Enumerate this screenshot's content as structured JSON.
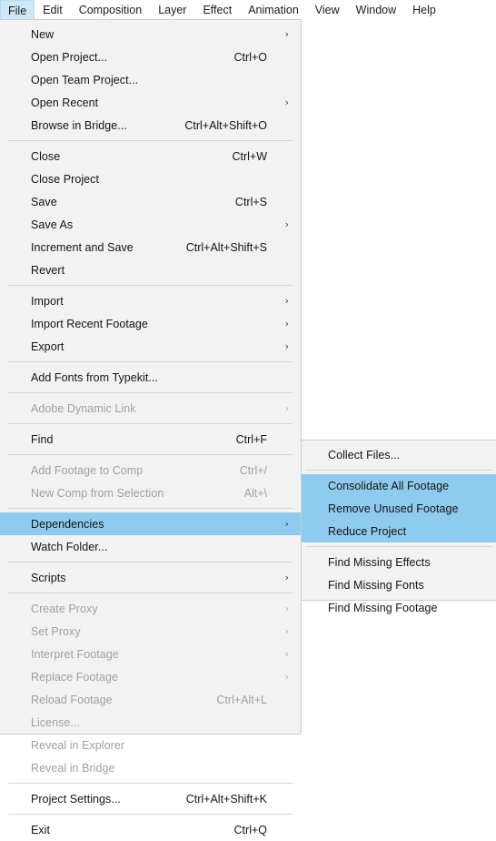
{
  "menubar": {
    "items": [
      {
        "label": "File",
        "active": true
      },
      {
        "label": "Edit",
        "active": false
      },
      {
        "label": "Composition",
        "active": false
      },
      {
        "label": "Layer",
        "active": false
      },
      {
        "label": "Effect",
        "active": false
      },
      {
        "label": "Animation",
        "active": false
      },
      {
        "label": "View",
        "active": false
      },
      {
        "label": "Window",
        "active": false
      },
      {
        "label": "Help",
        "active": false
      }
    ]
  },
  "colors": {
    "highlight": "#8fcbee",
    "menu_background": "#f2f2f2",
    "menubar_active": "#cce8f7",
    "text": "#141414",
    "text_disabled": "#a0a0a0",
    "separator": "#d6d6d6",
    "border": "#cdcdcd"
  },
  "file_menu": {
    "groups": [
      {
        "items": [
          {
            "label": "New",
            "accel": "",
            "submenu": true,
            "disabled": false,
            "highlight": false
          },
          {
            "label": "Open Project...",
            "accel": "Ctrl+O",
            "submenu": false,
            "disabled": false,
            "highlight": false
          },
          {
            "label": "Open Team Project...",
            "accel": "",
            "submenu": false,
            "disabled": false,
            "highlight": false
          },
          {
            "label": "Open Recent",
            "accel": "",
            "submenu": true,
            "disabled": false,
            "highlight": false
          },
          {
            "label": "Browse in Bridge...",
            "accel": "Ctrl+Alt+Shift+O",
            "submenu": false,
            "disabled": false,
            "highlight": false
          }
        ]
      },
      {
        "items": [
          {
            "label": "Close",
            "accel": "Ctrl+W",
            "submenu": false,
            "disabled": false,
            "highlight": false
          },
          {
            "label": "Close Project",
            "accel": "",
            "submenu": false,
            "disabled": false,
            "highlight": false
          },
          {
            "label": "Save",
            "accel": "Ctrl+S",
            "submenu": false,
            "disabled": false,
            "highlight": false
          },
          {
            "label": "Save As",
            "accel": "",
            "submenu": true,
            "disabled": false,
            "highlight": false
          },
          {
            "label": "Increment and Save",
            "accel": "Ctrl+Alt+Shift+S",
            "submenu": false,
            "disabled": false,
            "highlight": false
          },
          {
            "label": "Revert",
            "accel": "",
            "submenu": false,
            "disabled": false,
            "highlight": false
          }
        ]
      },
      {
        "items": [
          {
            "label": "Import",
            "accel": "",
            "submenu": true,
            "disabled": false,
            "highlight": false
          },
          {
            "label": "Import Recent Footage",
            "accel": "",
            "submenu": true,
            "disabled": false,
            "highlight": false
          },
          {
            "label": "Export",
            "accel": "",
            "submenu": true,
            "disabled": false,
            "highlight": false
          }
        ]
      },
      {
        "items": [
          {
            "label": "Add Fonts from Typekit...",
            "accel": "",
            "submenu": false,
            "disabled": false,
            "highlight": false
          }
        ]
      },
      {
        "items": [
          {
            "label": "Adobe Dynamic Link",
            "accel": "",
            "submenu": true,
            "disabled": true,
            "highlight": false
          }
        ]
      },
      {
        "items": [
          {
            "label": "Find",
            "accel": "Ctrl+F",
            "submenu": false,
            "disabled": false,
            "highlight": false
          }
        ]
      },
      {
        "items": [
          {
            "label": "Add Footage to Comp",
            "accel": "Ctrl+/",
            "submenu": false,
            "disabled": true,
            "highlight": false
          },
          {
            "label": "New Comp from Selection",
            "accel": "Alt+\\",
            "submenu": false,
            "disabled": true,
            "highlight": false
          }
        ]
      },
      {
        "items": [
          {
            "label": "Dependencies",
            "accel": "",
            "submenu": true,
            "disabled": false,
            "highlight": true
          },
          {
            "label": "Watch Folder...",
            "accel": "",
            "submenu": false,
            "disabled": false,
            "highlight": false
          }
        ]
      },
      {
        "items": [
          {
            "label": "Scripts",
            "accel": "",
            "submenu": true,
            "disabled": false,
            "highlight": false
          }
        ]
      },
      {
        "items": [
          {
            "label": "Create Proxy",
            "accel": "",
            "submenu": true,
            "disabled": true,
            "highlight": false
          },
          {
            "label": "Set Proxy",
            "accel": "",
            "submenu": true,
            "disabled": true,
            "highlight": false
          },
          {
            "label": "Interpret Footage",
            "accel": "",
            "submenu": true,
            "disabled": true,
            "highlight": false
          },
          {
            "label": "Replace Footage",
            "accel": "",
            "submenu": true,
            "disabled": true,
            "highlight": false
          },
          {
            "label": "Reload Footage",
            "accel": "Ctrl+Alt+L",
            "submenu": false,
            "disabled": true,
            "highlight": false
          },
          {
            "label": "License...",
            "accel": "",
            "submenu": false,
            "disabled": true,
            "highlight": false
          },
          {
            "label": "Reveal in Explorer",
            "accel": "",
            "submenu": false,
            "disabled": true,
            "highlight": false
          },
          {
            "label": "Reveal in Bridge",
            "accel": "",
            "submenu": false,
            "disabled": true,
            "highlight": false
          }
        ]
      },
      {
        "items": [
          {
            "label": "Project Settings...",
            "accel": "Ctrl+Alt+Shift+K",
            "submenu": false,
            "disabled": false,
            "highlight": false
          }
        ]
      },
      {
        "items": [
          {
            "label": "Exit",
            "accel": "Ctrl+Q",
            "submenu": false,
            "disabled": false,
            "highlight": false
          }
        ]
      }
    ]
  },
  "dependencies_submenu": {
    "groups": [
      {
        "items": [
          {
            "label": "Collect Files...",
            "accel": "",
            "submenu": false,
            "disabled": false,
            "highlight": false
          }
        ]
      },
      {
        "items": [
          {
            "label": "Consolidate All Footage",
            "accel": "",
            "submenu": false,
            "disabled": false,
            "highlight": true
          },
          {
            "label": "Remove Unused Footage",
            "accel": "",
            "submenu": false,
            "disabled": false,
            "highlight": true
          },
          {
            "label": "Reduce Project",
            "accel": "",
            "submenu": false,
            "disabled": false,
            "highlight": true
          }
        ]
      },
      {
        "items": [
          {
            "label": "Find Missing Effects",
            "accel": "",
            "submenu": false,
            "disabled": false,
            "highlight": false
          },
          {
            "label": "Find Missing Fonts",
            "accel": "",
            "submenu": false,
            "disabled": false,
            "highlight": false
          },
          {
            "label": "Find Missing Footage",
            "accel": "",
            "submenu": false,
            "disabled": false,
            "highlight": false
          }
        ]
      }
    ]
  }
}
